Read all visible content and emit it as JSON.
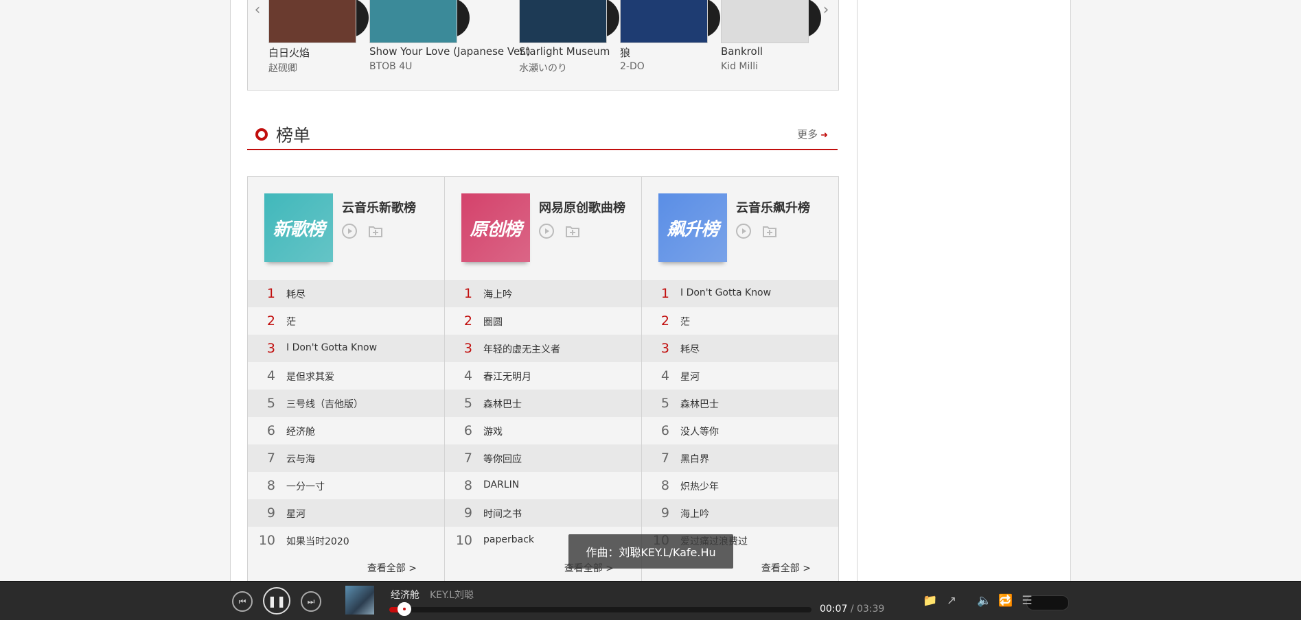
{
  "albums": [
    {
      "name": "白日火焰",
      "artist": "赵砚卿",
      "cover": "#6a3b2f"
    },
    {
      "name": "Show Your Love (Japanese Ver.)",
      "artist": "BTOB 4U",
      "cover": "#3b8a99"
    },
    {
      "name": "Starlight Museum",
      "artist": "水瀬いのり",
      "cover": "#1d3a55"
    },
    {
      "name": "狼",
      "artist": "2-DO",
      "cover": "#1e3c72"
    },
    {
      "name": "Bankroll",
      "artist": "Kid Milli",
      "cover": "#dcdcdc"
    }
  ],
  "carousel": {
    "prev_icon": "‹",
    "next_icon": "›"
  },
  "section": {
    "title": "榜单",
    "more": "更多",
    "more_icon": "➜"
  },
  "charts": [
    {
      "cover_text": "新歌榜",
      "cover_color": "#41b8bb",
      "title": "云音乐新歌榜",
      "songs": [
        "耗尽",
        "茫",
        "I Don't Gotta Know",
        "是但求其爱",
        "三号线（吉他版）",
        "经济舱",
        "云与海",
        "一分一寸",
        "星河",
        "如果当时2020"
      ],
      "see_all": "查看全部 >"
    },
    {
      "cover_text": "原创榜",
      "cover_color": "#d4426b",
      "title": "网易原创歌曲榜",
      "songs": [
        "海上吟",
        "圈圆",
        "年轻的虚无主义者",
        "春江无明月",
        "森林巴士",
        "游戏",
        "等你回应",
        "DARLIN",
        "时间之书",
        "paperback"
      ],
      "see_all": "查看全部 >"
    },
    {
      "cover_text": "飙升榜",
      "cover_color": "#5a8ee6",
      "title": "云音乐飙升榜",
      "songs": [
        "I Don't Gotta Know",
        "茫",
        "耗尽",
        "星河",
        "森林巴士",
        "没人等你",
        "黑白界",
        "炽热少年",
        "海上吟",
        "爱过痛过浪费过"
      ],
      "see_all": "查看全部 >"
    }
  ],
  "ranks": [
    "1",
    "2",
    "3",
    "4",
    "5",
    "6",
    "7",
    "8",
    "9",
    "10"
  ],
  "tooltip": "作曲：刘聪KEY.L/Kafe.Hu",
  "player": {
    "song": "经济舱",
    "artist": "KEY.L刘聪",
    "current": "00:07",
    "separator": "/",
    "duration": "03:39",
    "progress": 0.035,
    "prev_icon": "⏮",
    "play_icon": "❚❚",
    "next_icon": "⏭",
    "icons": [
      "📁",
      "↗",
      "🔈",
      "🔁",
      "☰"
    ]
  },
  "colors": {
    "accent": "#c10d0c"
  }
}
